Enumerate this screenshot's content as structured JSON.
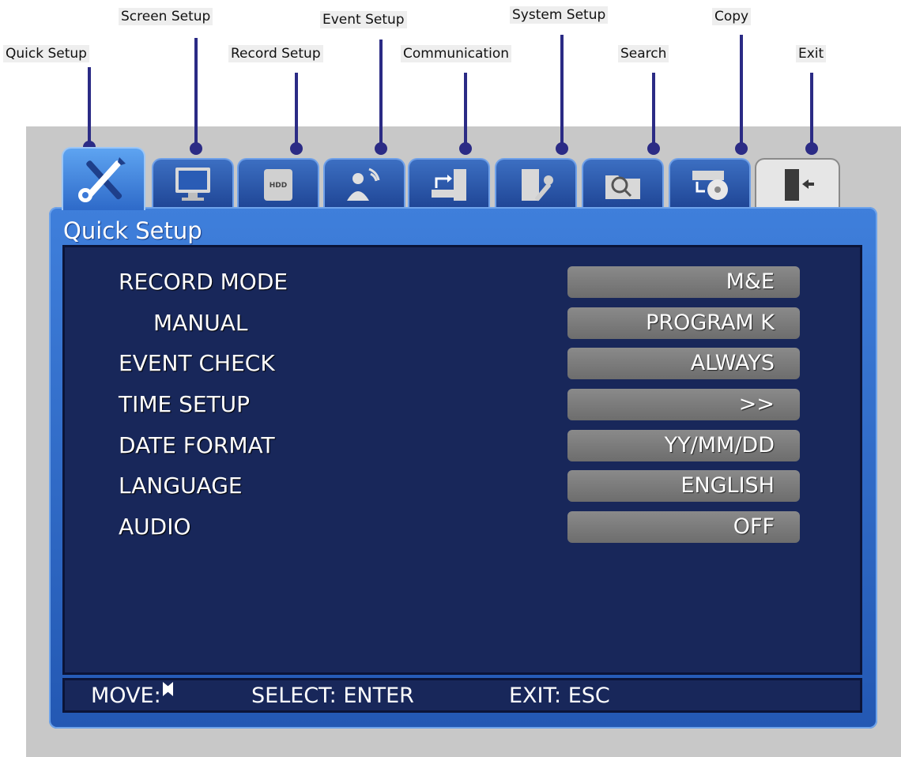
{
  "callouts": {
    "quick_setup": "Quick Setup",
    "screen_setup": "Screen Setup",
    "record_setup": "Record Setup",
    "event_setup": "Event Setup",
    "communication": "Communication",
    "system_setup": "System Setup",
    "search": "Search",
    "copy": "Copy",
    "exit": "Exit"
  },
  "tabs": [
    {
      "icon": "tools-icon",
      "active": true
    },
    {
      "icon": "monitor-icon"
    },
    {
      "icon": "hdd-icon",
      "text": "HDD"
    },
    {
      "icon": "sensor-person-icon"
    },
    {
      "icon": "network-transfer-icon"
    },
    {
      "icon": "system-tools-icon"
    },
    {
      "icon": "search-folder-icon"
    },
    {
      "icon": "copy-disc-icon"
    },
    {
      "icon": "exit-door-icon"
    }
  ],
  "window": {
    "title": "Quick Setup"
  },
  "rows": [
    {
      "label": "RECORD MODE",
      "value": "M&E"
    },
    {
      "label": "MANUAL",
      "value": "PROGRAM K"
    },
    {
      "label": "EVENT CHECK",
      "value": "ALWAYS"
    },
    {
      "label": "TIME SETUP",
      "value": ">>"
    },
    {
      "label": "DATE FORMAT",
      "value": "YY/MM/DD"
    },
    {
      "label": "LANGUAGE",
      "value": "ENGLISH"
    },
    {
      "label": "AUDIO",
      "value": "OFF"
    }
  ],
  "footer": {
    "move": "MOVE:",
    "select": "SELECT: ENTER",
    "exit": "EXIT: ESC"
  },
  "colors": {
    "accent": "#2b2b85",
    "window_blue": "#3f7fdb",
    "content_navy": "#18275a",
    "value_grey": "#7b7b7b"
  }
}
